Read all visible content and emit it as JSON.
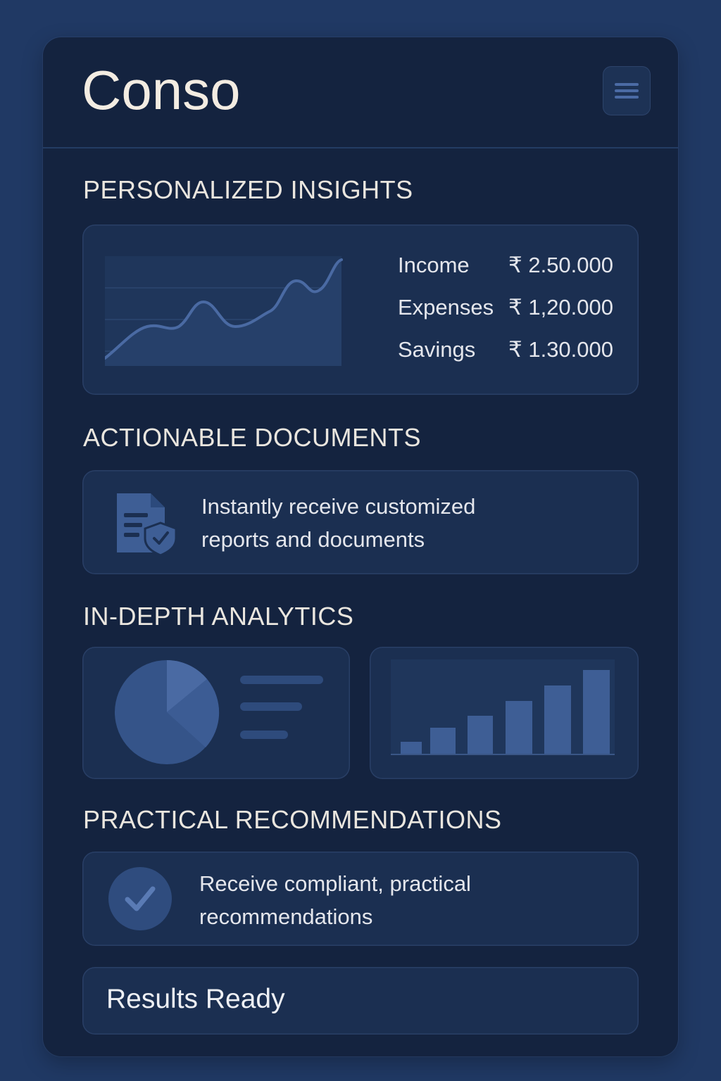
{
  "app": {
    "title": "Conso"
  },
  "header": {
    "menu_icon": "hamburger-menu-icon"
  },
  "insights": {
    "title": "PERSONALIZED INSIGHTS",
    "stats": [
      {
        "label": "Income",
        "value": "₹ 2.50.000"
      },
      {
        "label": "Expenses",
        "value": "₹ 1,20.000"
      },
      {
        "label": "Savings",
        "value": "₹ 1.30.000"
      }
    ]
  },
  "documents": {
    "title": "ACTIONABLE DOCUMENTS",
    "icon": "secure-document-icon",
    "text_line1": "Instantly receive customized",
    "text_line2": "reports and documents"
  },
  "analytics": {
    "title": "IN-DEPTH ANALYTICS",
    "pie_icon": "pie-chart-icon",
    "bar_icon": "bar-chart-icon"
  },
  "recommendations": {
    "title": "PRACTICAL RECOMMENDATIONS",
    "icon": "checkmark-circle-icon",
    "text_line1": "Receive compliant, practical",
    "text_line2": "recommendations"
  },
  "results": {
    "label": "Results Ready"
  },
  "colors": {
    "background": "#203964",
    "panel": "#14233f",
    "card": "#1b2f51",
    "accent": "#4a6aa3",
    "text": "#eae6df"
  }
}
